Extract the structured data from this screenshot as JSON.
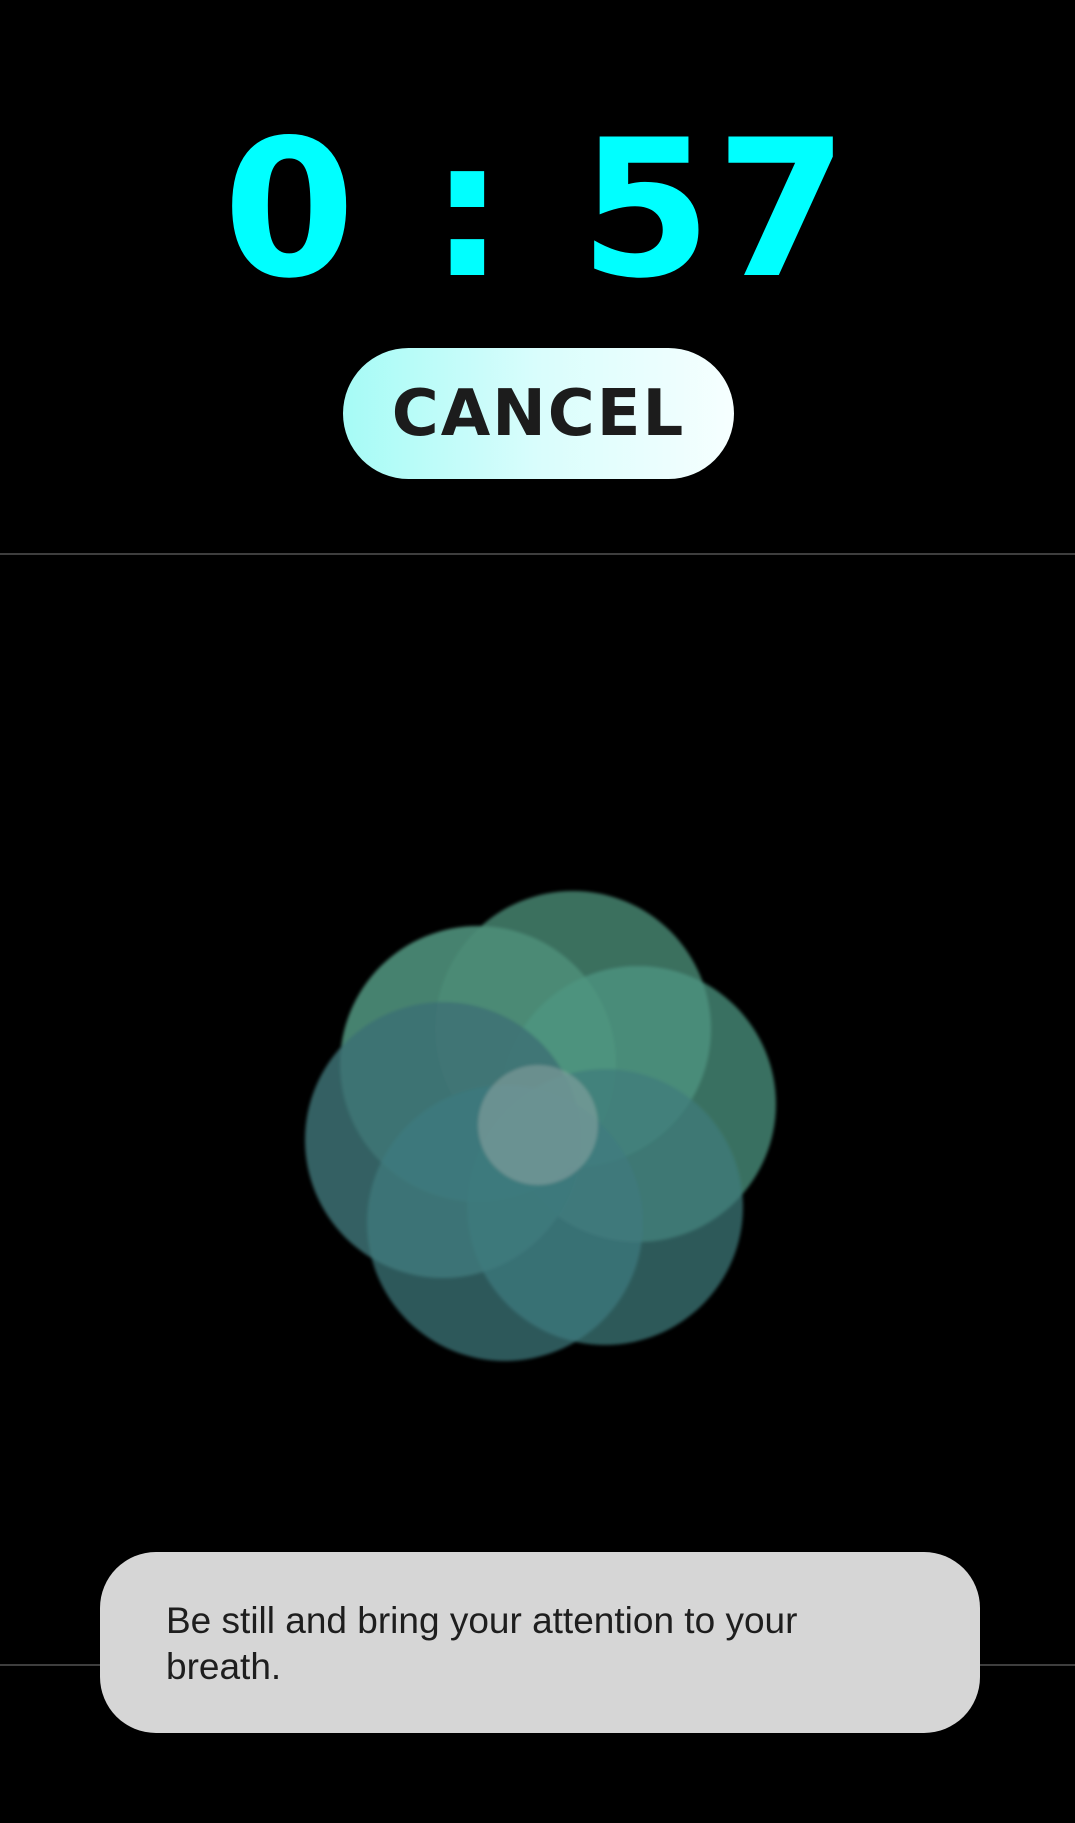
{
  "timer": {
    "display": "0 : 57",
    "color": "#00FFFF"
  },
  "cancel_button": {
    "label": "CANCEL"
  },
  "breathing_animation": {
    "icon": "breathing-flower-icon",
    "colors": [
      "#3e8a78",
      "#5aa5a0",
      "#356870"
    ]
  },
  "toast": {
    "message": "Be still and bring your attention to your breath."
  }
}
